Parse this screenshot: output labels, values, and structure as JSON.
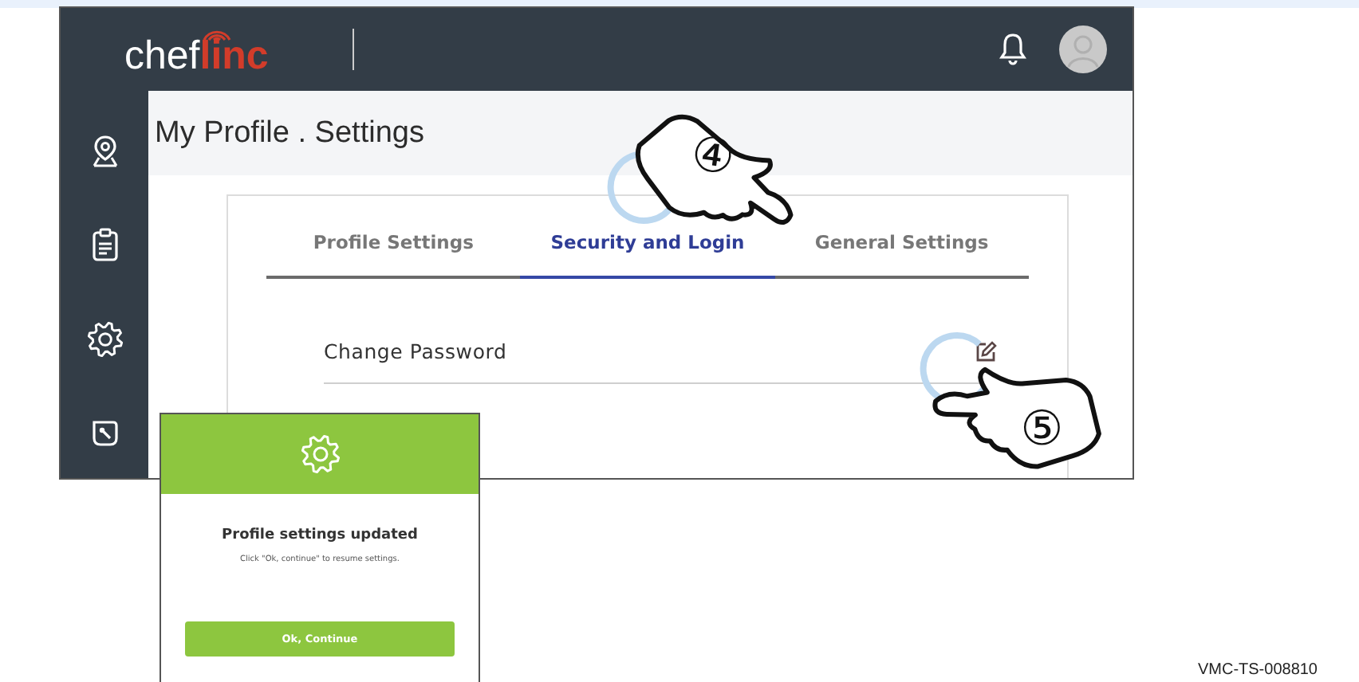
{
  "header": {
    "logo": {
      "part_1": "chef",
      "part_2": "linc"
    }
  },
  "page_title": "My Profile . Settings",
  "tabs": [
    {
      "label": "Profile Settings",
      "selected": false
    },
    {
      "label": "Security and Login",
      "selected": true
    },
    {
      "label": "General Settings",
      "selected": false
    }
  ],
  "settings_rows": [
    {
      "label": "Change Password"
    }
  ],
  "callouts": [
    {
      "label": "④"
    },
    {
      "label": "⑤"
    }
  ],
  "dialog": {
    "title": "Profile settings updated",
    "message": "Click \"Ok, continue\" to resume settings.",
    "button": "Ok, Continue"
  },
  "document_code": "VMC-TS-008810"
}
